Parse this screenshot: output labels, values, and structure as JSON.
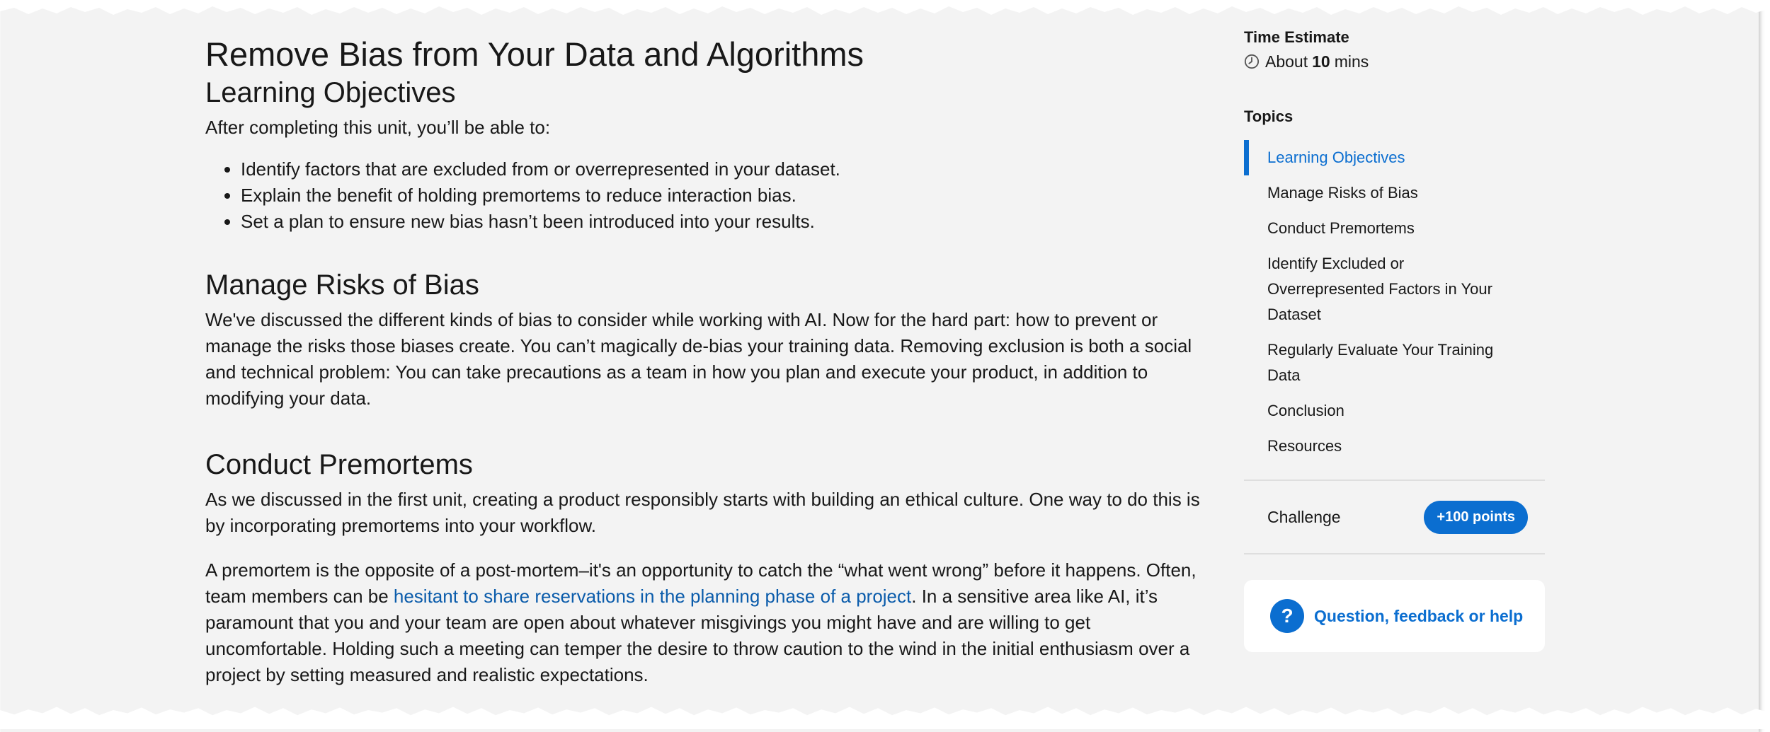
{
  "article": {
    "title": "Remove Bias from Your Data and Algorithms",
    "objectives_heading": "Learning Objectives",
    "objectives_intro": "After completing this unit, you’ll be able to:",
    "objectives": [
      "Identify factors that are excluded from or overrepresented in your dataset.",
      "Explain the benefit of holding premortems to reduce interaction bias.",
      "Set a plan to ensure new bias hasn’t been introduced into your results."
    ],
    "section2": {
      "heading": "Manage Risks of Bias",
      "body": "We've discussed the different kinds of bias to consider while working with AI. Now for the hard part: how to prevent or manage the risks those biases create. You can’t magically de-bias your training data. Removing exclusion is both a social and technical problem: You can take precautions as a team in how you plan and execute your product, in addition to modifying your data."
    },
    "section3": {
      "heading": "Conduct Premortems",
      "body1": "As we discussed in the first unit, creating a product responsibly starts with building an ethical culture. One way to do this is by  incorporating premortems into your workflow.",
      "body2_before": "A premortem is the opposite of a post-mortem–it's an opportunity to catch the “what went wrong” before it happens. Often, team members can be ",
      "body2_link": "hesitant to share reservations in the planning phase of a project",
      "body2_after": ". In a sensitive area like AI, it’s paramount that you and your team are open about whatever misgivings you might have and are willing to get uncomfortable. Holding such a meeting can temper the desire to throw caution to the wind in the initial enthusiasm over a project by setting measured and realistic expectations."
    }
  },
  "sidebar": {
    "time_label": "Time Estimate",
    "time_prefix": "About",
    "time_value": "10",
    "time_unit": "mins",
    "topics_label": "Topics",
    "topics": [
      {
        "label": "Learning Objectives",
        "active": true
      },
      {
        "label": "Manage Risks of Bias",
        "active": false
      },
      {
        "label": "Conduct Premortems",
        "active": false
      },
      {
        "label": "Identify Excluded or Overrepresented Factors in Your Dataset",
        "active": false
      },
      {
        "label": "Regularly Evaluate Your Training Data",
        "active": false
      },
      {
        "label": "Conclusion",
        "active": false
      },
      {
        "label": "Resources",
        "active": false
      }
    ],
    "challenge_label": "Challenge",
    "points_badge": "+100 points",
    "help_label": "Question, feedback or help",
    "help_icon_glyph": "?"
  },
  "colors": {
    "accent": "#0b6ed0",
    "link": "#0b5cab",
    "page_background": "#f3f3f3"
  },
  "icons": [
    "clock-icon",
    "question-icon"
  ]
}
